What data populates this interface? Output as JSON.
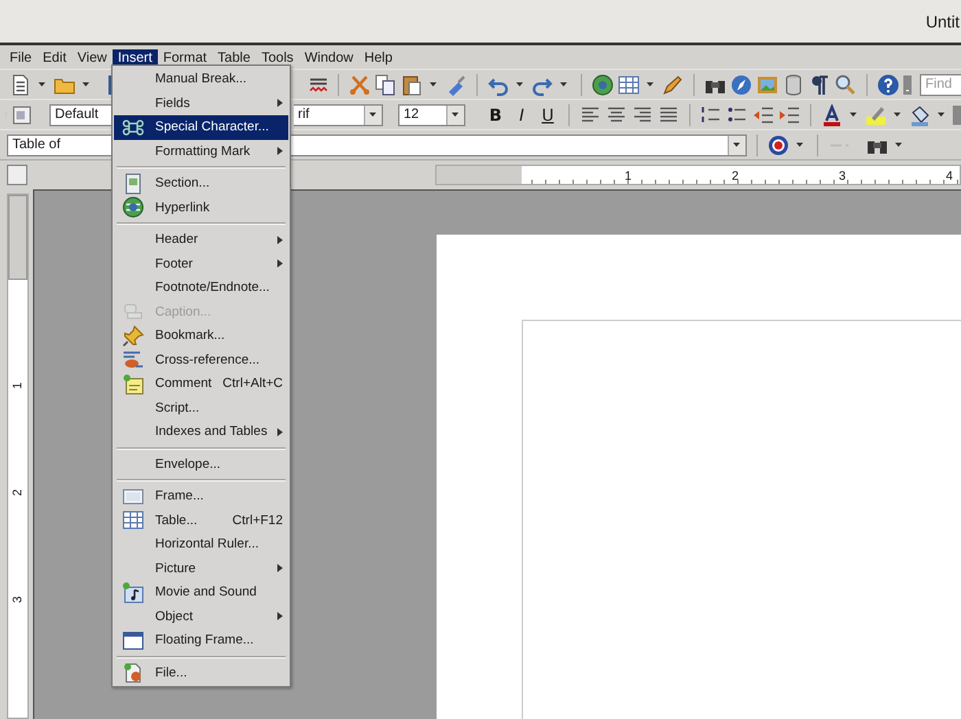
{
  "window": {
    "title": "Untit"
  },
  "menu_bar": [
    {
      "label": "File",
      "selected": false
    },
    {
      "label": "Edit",
      "selected": false
    },
    {
      "label": "View",
      "selected": false
    },
    {
      "label": "Insert",
      "selected": true
    },
    {
      "label": "Format",
      "selected": false
    },
    {
      "label": "Table",
      "selected": false
    },
    {
      "label": "Tools",
      "selected": false
    },
    {
      "label": "Window",
      "selected": false
    },
    {
      "label": "Help",
      "selected": false
    }
  ],
  "standard_toolbar": {
    "find_field": {
      "placeholder": "Find"
    }
  },
  "formatting_toolbar": {
    "paragraph_style": "Default",
    "font_name": "rif",
    "font_size": "12",
    "style_buttons": [
      "B",
      "I",
      "U"
    ]
  },
  "navigation_toolbar": {
    "index_field": "Table of"
  },
  "horizontal_ruler": {
    "labels": [
      "1",
      "2",
      "3",
      "4"
    ]
  },
  "vertical_ruler": {
    "labels": [
      "1",
      "2",
      "3"
    ]
  },
  "insert_menu": {
    "items": [
      {
        "kind": "item",
        "label": "Manual Break...",
        "submenu": false,
        "disabled": false,
        "selected": false
      },
      {
        "kind": "item",
        "label": "Fields",
        "submenu": true,
        "disabled": false,
        "selected": false
      },
      {
        "kind": "item",
        "label": "Special Character...",
        "submenu": false,
        "disabled": false,
        "selected": true
      },
      {
        "kind": "item",
        "label": "Formatting Mark",
        "submenu": true,
        "disabled": false,
        "selected": false
      },
      {
        "kind": "separator"
      },
      {
        "kind": "item",
        "label": "Section...",
        "submenu": false,
        "disabled": false,
        "selected": false
      },
      {
        "kind": "item",
        "label": "Hyperlink",
        "submenu": false,
        "disabled": false,
        "selected": false
      },
      {
        "kind": "separator"
      },
      {
        "kind": "item",
        "label": "Header",
        "submenu": true,
        "disabled": false,
        "selected": false
      },
      {
        "kind": "item",
        "label": "Footer",
        "submenu": true,
        "disabled": false,
        "selected": false
      },
      {
        "kind": "item",
        "label": "Footnote/Endnote...",
        "submenu": false,
        "disabled": false,
        "selected": false
      },
      {
        "kind": "item",
        "label": "Caption...",
        "submenu": false,
        "disabled": true,
        "selected": false
      },
      {
        "kind": "item",
        "label": "Bookmark...",
        "submenu": false,
        "disabled": false,
        "selected": false
      },
      {
        "kind": "item",
        "label": "Cross-reference...",
        "submenu": false,
        "disabled": false,
        "selected": false
      },
      {
        "kind": "item",
        "label": "Comment",
        "shortcut": "Ctrl+Alt+C",
        "submenu": false,
        "disabled": false,
        "selected": false
      },
      {
        "kind": "item",
        "label": "Script...",
        "submenu": false,
        "disabled": false,
        "selected": false
      },
      {
        "kind": "item",
        "label": "Indexes and Tables",
        "submenu": true,
        "disabled": false,
        "selected": false
      },
      {
        "kind": "separator"
      },
      {
        "kind": "item",
        "label": "Envelope...",
        "submenu": false,
        "disabled": false,
        "selected": false
      },
      {
        "kind": "separator"
      },
      {
        "kind": "item",
        "label": "Frame...",
        "submenu": false,
        "disabled": false,
        "selected": false
      },
      {
        "kind": "item",
        "label": "Table...",
        "shortcut": "Ctrl+F12",
        "submenu": false,
        "disabled": false,
        "selected": false
      },
      {
        "kind": "item",
        "label": "Horizontal Ruler...",
        "submenu": false,
        "disabled": false,
        "selected": false
      },
      {
        "kind": "item",
        "label": "Picture",
        "submenu": true,
        "disabled": false,
        "selected": false
      },
      {
        "kind": "item",
        "label": "Movie and Sound",
        "submenu": false,
        "disabled": false,
        "selected": false
      },
      {
        "kind": "item",
        "label": "Object",
        "submenu": true,
        "disabled": false,
        "selected": false
      },
      {
        "kind": "item",
        "label": "Floating Frame...",
        "submenu": false,
        "disabled": false,
        "selected": false
      },
      {
        "kind": "separator"
      },
      {
        "kind": "item",
        "label": "File...",
        "submenu": false,
        "disabled": false,
        "selected": false
      }
    ]
  }
}
